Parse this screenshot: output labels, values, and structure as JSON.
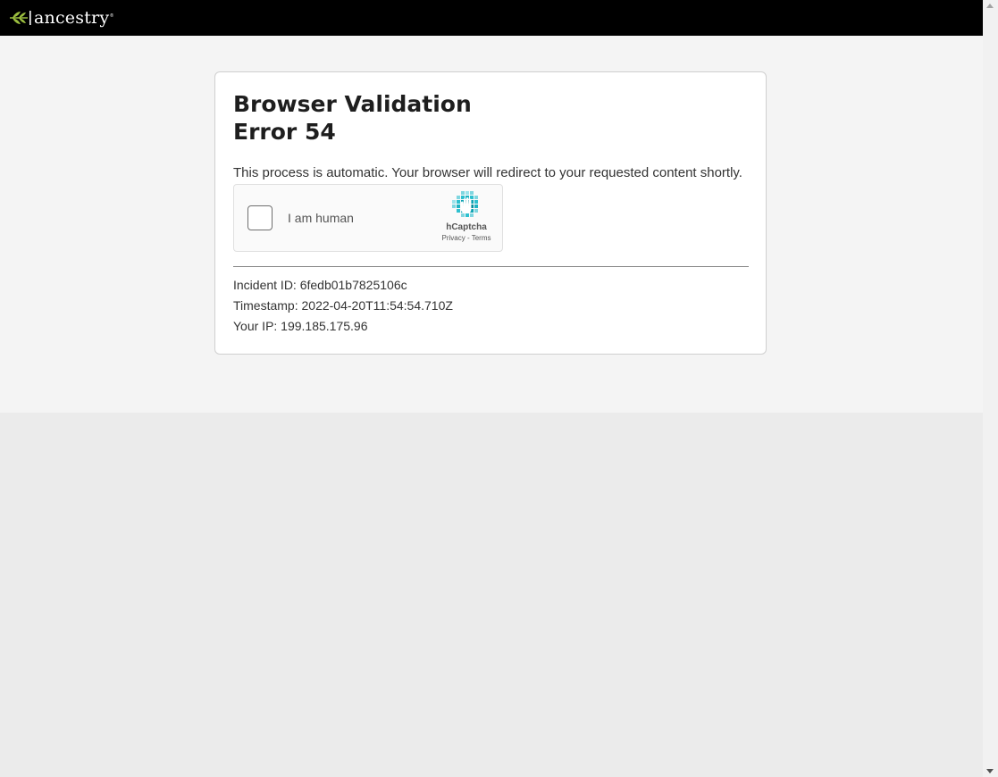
{
  "header": {
    "logo_text": "ancestry",
    "logo_mark": "®",
    "logo_icon": "leaf-logo-icon",
    "background": "#000000",
    "accent": "#9bbe3f"
  },
  "card": {
    "title_line1": "Browser Validation",
    "title_line2": "Error 54",
    "description": "This process is automatic. Your browser will redirect to your requested content shortly."
  },
  "captcha": {
    "label": "I am human",
    "brand": "hCaptcha",
    "privacy_link": "Privacy",
    "separator": " - ",
    "terms_link": "Terms",
    "checked": false,
    "logo_icon": "hcaptcha-hand-icon",
    "accent": "#0fa3b3"
  },
  "info": {
    "incident": "Incident ID: 6fedb01b7825106c",
    "timestamp": "Timestamp: 2022-04-20T11:54:54.710Z",
    "ip": "Your IP: 199.185.175.96"
  },
  "colors": {
    "page_bg": "#f4f4f4",
    "outer_bg": "#ebebeb",
    "card_bg": "#ffffff",
    "text": "#333333"
  }
}
